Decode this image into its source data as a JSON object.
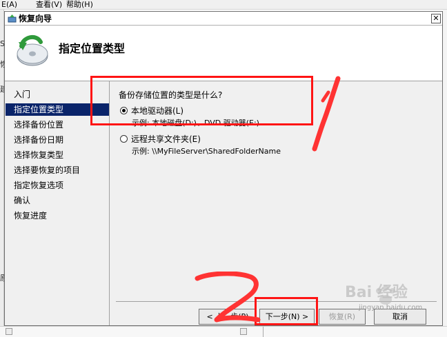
{
  "background_app": {
    "menu": [
      "E(A)",
      "查看(V)",
      "帮助(H)"
    ],
    "scraps": [
      "S",
      "恢",
      "建",
      "原"
    ]
  },
  "window": {
    "title": "恢复向导",
    "close_glyph": "✕",
    "header_title": "指定位置类型"
  },
  "nav": {
    "items": [
      {
        "label": "入门",
        "active": false
      },
      {
        "label": "指定位置类型",
        "active": true
      },
      {
        "label": "选择备份位置",
        "active": false
      },
      {
        "label": "选择备份日期",
        "active": false
      },
      {
        "label": "选择恢复类型",
        "active": false
      },
      {
        "label": "选择要恢复的项目",
        "active": false
      },
      {
        "label": "指定恢复选项",
        "active": false
      },
      {
        "label": "确认",
        "active": false
      },
      {
        "label": "恢复进度",
        "active": false
      }
    ]
  },
  "content": {
    "question": "备份存储位置的类型是什么?",
    "options": [
      {
        "label": "本地驱动器(L)",
        "example": "示例: 本地磁盘(D:)、DVD 驱动器(E:)",
        "checked": true
      },
      {
        "label": "远程共享文件夹(E)",
        "example": "示例: \\\\MyFileServer\\SharedFolderName",
        "checked": false
      }
    ]
  },
  "buttons": {
    "back": "< 上一步(P)",
    "next": "下一步(N) >",
    "recover": "恢复(R)",
    "cancel": "取消"
  },
  "annotations": {
    "mark_1": "1",
    "mark_2": "2",
    "highlight_color": "#ff1414"
  },
  "watermark": {
    "brand": "Bai 经验",
    "url": "jingyan.baidu.com"
  },
  "colors": {
    "nav_active_bg": "#0a246a",
    "window_bg": "#f0f0f0"
  }
}
